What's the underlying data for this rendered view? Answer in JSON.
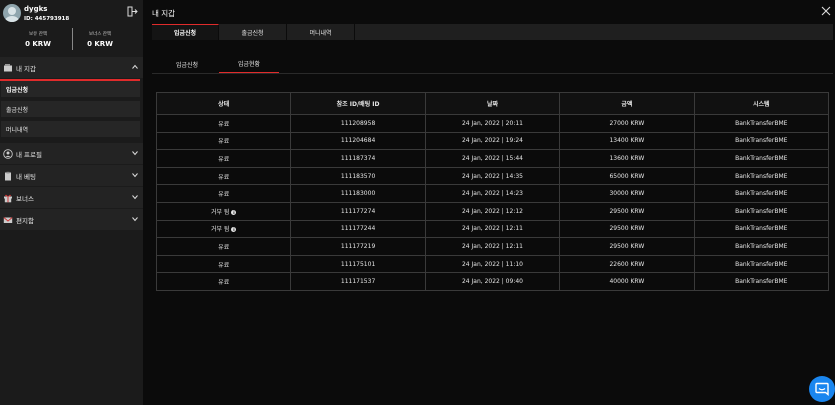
{
  "user": {
    "name": "dygks",
    "id_label": "ID: 445793918"
  },
  "balances": [
    {
      "label": "보유 잔액",
      "value": "0 KRW"
    },
    {
      "label": "보너스 잔액",
      "value": "0 KRW"
    }
  ],
  "menu": {
    "wallet": "내 지갑",
    "wallet_items": [
      "입금신청",
      "출금신청",
      "머니내역"
    ],
    "profile": "내 프로필",
    "bets": "내 베팅",
    "bonus": "보너스",
    "inbox": "편지함"
  },
  "main": {
    "title": "내 지갑",
    "tabs": [
      "입금신청",
      "출금신청",
      "머니내역"
    ],
    "sub_tabs": [
      "입금신청",
      "입금현황"
    ]
  },
  "table": {
    "headers": [
      "상태",
      "참조 ID/배팅 ID",
      "날짜",
      "금액",
      "시스템"
    ],
    "rows": [
      {
        "status": "유료",
        "ref": "111208958",
        "date": "24 Jan, 2022 | 20:11",
        "amount": "27000 KRW",
        "system": "BankTransferBME"
      },
      {
        "status": "유료",
        "ref": "111204684",
        "date": "24 Jan, 2022 | 19:24",
        "amount": "13400 KRW",
        "system": "BankTransferBME"
      },
      {
        "status": "유료",
        "ref": "111187374",
        "date": "24 Jan, 2022 | 15:44",
        "amount": "13600 KRW",
        "system": "BankTransferBME"
      },
      {
        "status": "유료",
        "ref": "111183570",
        "date": "24 Jan, 2022 | 14:35",
        "amount": "65000 KRW",
        "system": "BankTransferBME"
      },
      {
        "status": "유료",
        "ref": "111183000",
        "date": "24 Jan, 2022 | 14:23",
        "amount": "30000 KRW",
        "system": "BankTransferBME"
      },
      {
        "status": "거부 됨",
        "ref": "111177274",
        "date": "24 Jan, 2022 | 12:12",
        "amount": "29500 KRW",
        "system": "BankTransferBME"
      },
      {
        "status": "거부 됨",
        "ref": "111177244",
        "date": "24 Jan, 2022 | 12:11",
        "amount": "29500 KRW",
        "system": "BankTransferBME"
      },
      {
        "status": "유료",
        "ref": "111177219",
        "date": "24 Jan, 2022 | 12:11",
        "amount": "29500 KRW",
        "system": "BankTransferBME"
      },
      {
        "status": "유료",
        "ref": "111175101",
        "date": "24 Jan, 2022 | 11:10",
        "amount": "22600 KRW",
        "system": "BankTransferBME"
      },
      {
        "status": "유료",
        "ref": "111171537",
        "date": "24 Jan, 2022 | 09:40",
        "amount": "40000 KRW",
        "system": "BankTransferBME"
      }
    ]
  },
  "info_glyph": "i",
  "colors": {
    "accent": "#e02b2b",
    "chat": "#1a86ef"
  }
}
